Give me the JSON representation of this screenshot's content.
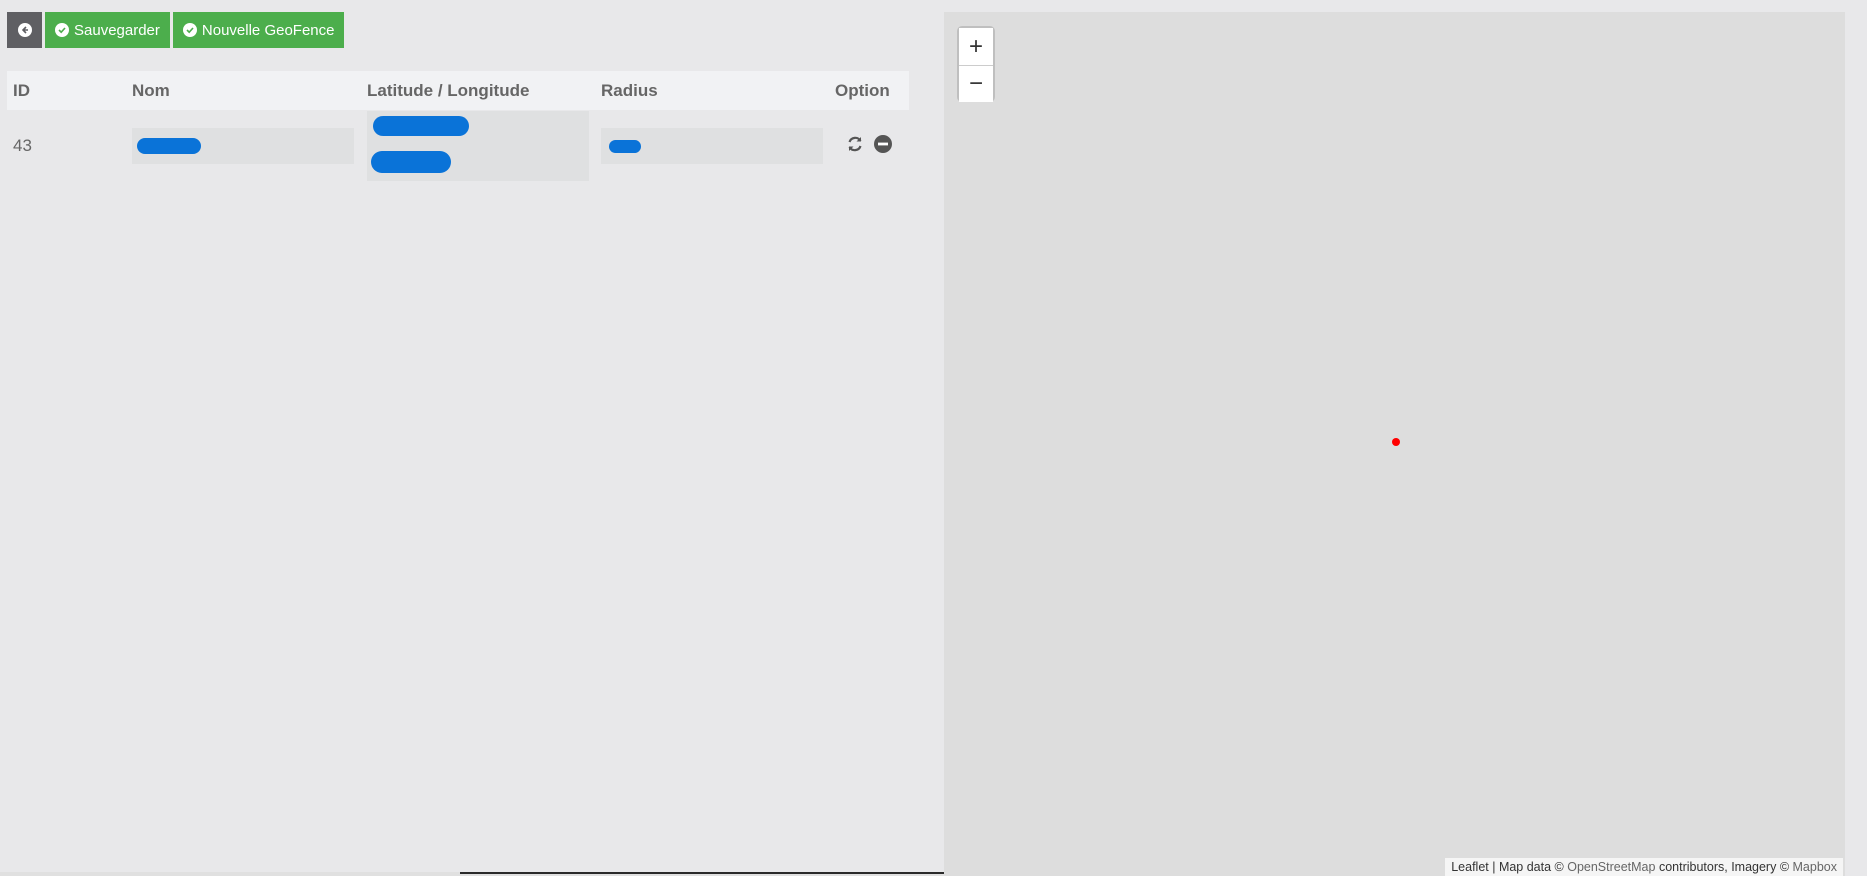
{
  "toolbar": {
    "back_icon": "arrow-left-icon",
    "save_label": "Sauvegarder",
    "new_geofence_label": "Nouvelle GeoFence"
  },
  "table": {
    "headers": [
      "ID",
      "Nom",
      "Latitude / Longitude",
      "Radius",
      "Option"
    ],
    "rows": [
      {
        "id": "43",
        "option_icons": [
          "refresh-icon",
          "remove-icon"
        ]
      }
    ]
  },
  "map": {
    "zoom_in": "+",
    "zoom_out": "−",
    "attribution": {
      "leaflet": "Leaflet",
      "sep": " | Map data © ",
      "osm": "OpenStreetMap",
      "contributors": " contributors, Imagery © ",
      "mapbox": "Mapbox"
    },
    "marker_color": "#ff0000"
  },
  "colors": {
    "accent_green": "#4cae4c",
    "back_button": "#5f5f63",
    "redaction": "#0a73d8"
  }
}
